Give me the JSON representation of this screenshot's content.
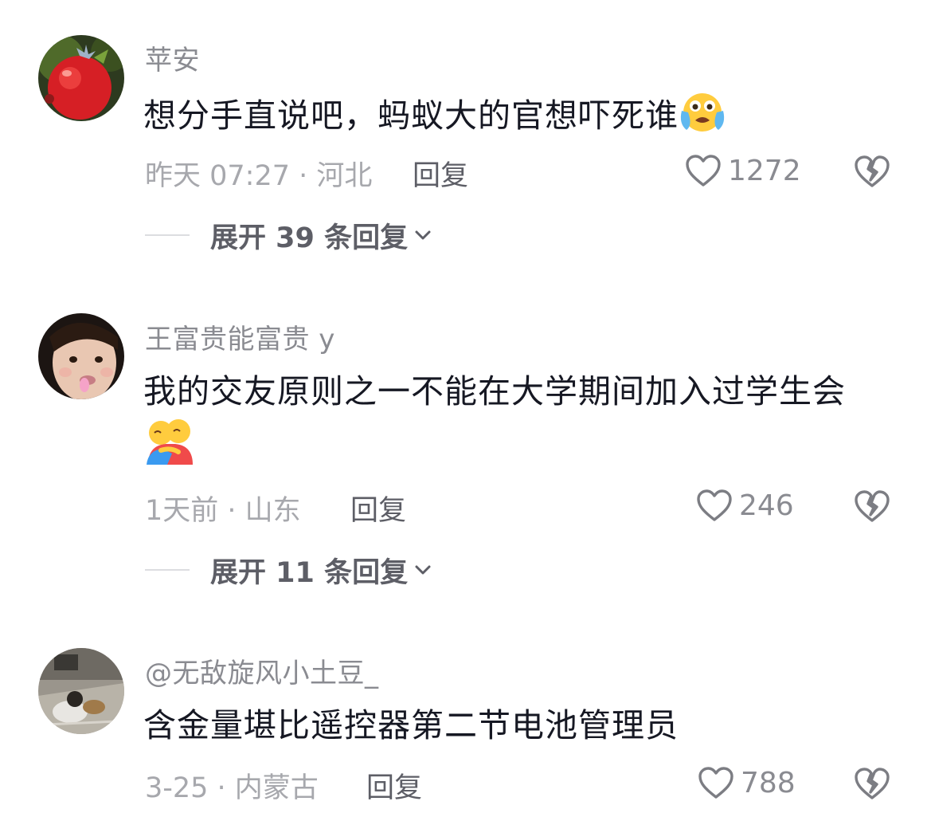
{
  "comments": [
    {
      "username": "苹安",
      "text": "想分手直说吧，蚂蚁大的官想吓死谁",
      "emoji": "crying-laughing-emoji",
      "time_location": "昨天 07:27 · 河北",
      "reply_label": "回复",
      "likes": "1272",
      "expand_label": "展开 39 条回复"
    },
    {
      "username": "王富贵能富贵 y",
      "text": "我的交友原则之一不能在大学期间加入过学生会",
      "emoji": "hugging-people-emoji",
      "time_location": "1天前 · 山东",
      "reply_label": "回复",
      "likes": "246",
      "expand_label": "展开 11 条回复"
    },
    {
      "username": "@无敌旋风小土豆_",
      "text": "含金量堪比遥控器第二节电池管理员",
      "time_location": "3-25 · 内蒙古",
      "reply_label": "回复",
      "likes": "788"
    }
  ],
  "colors": {
    "username": "#8a8b91",
    "text": "#161823",
    "meta": "#a7a8ad",
    "action": "#5d5e66"
  }
}
